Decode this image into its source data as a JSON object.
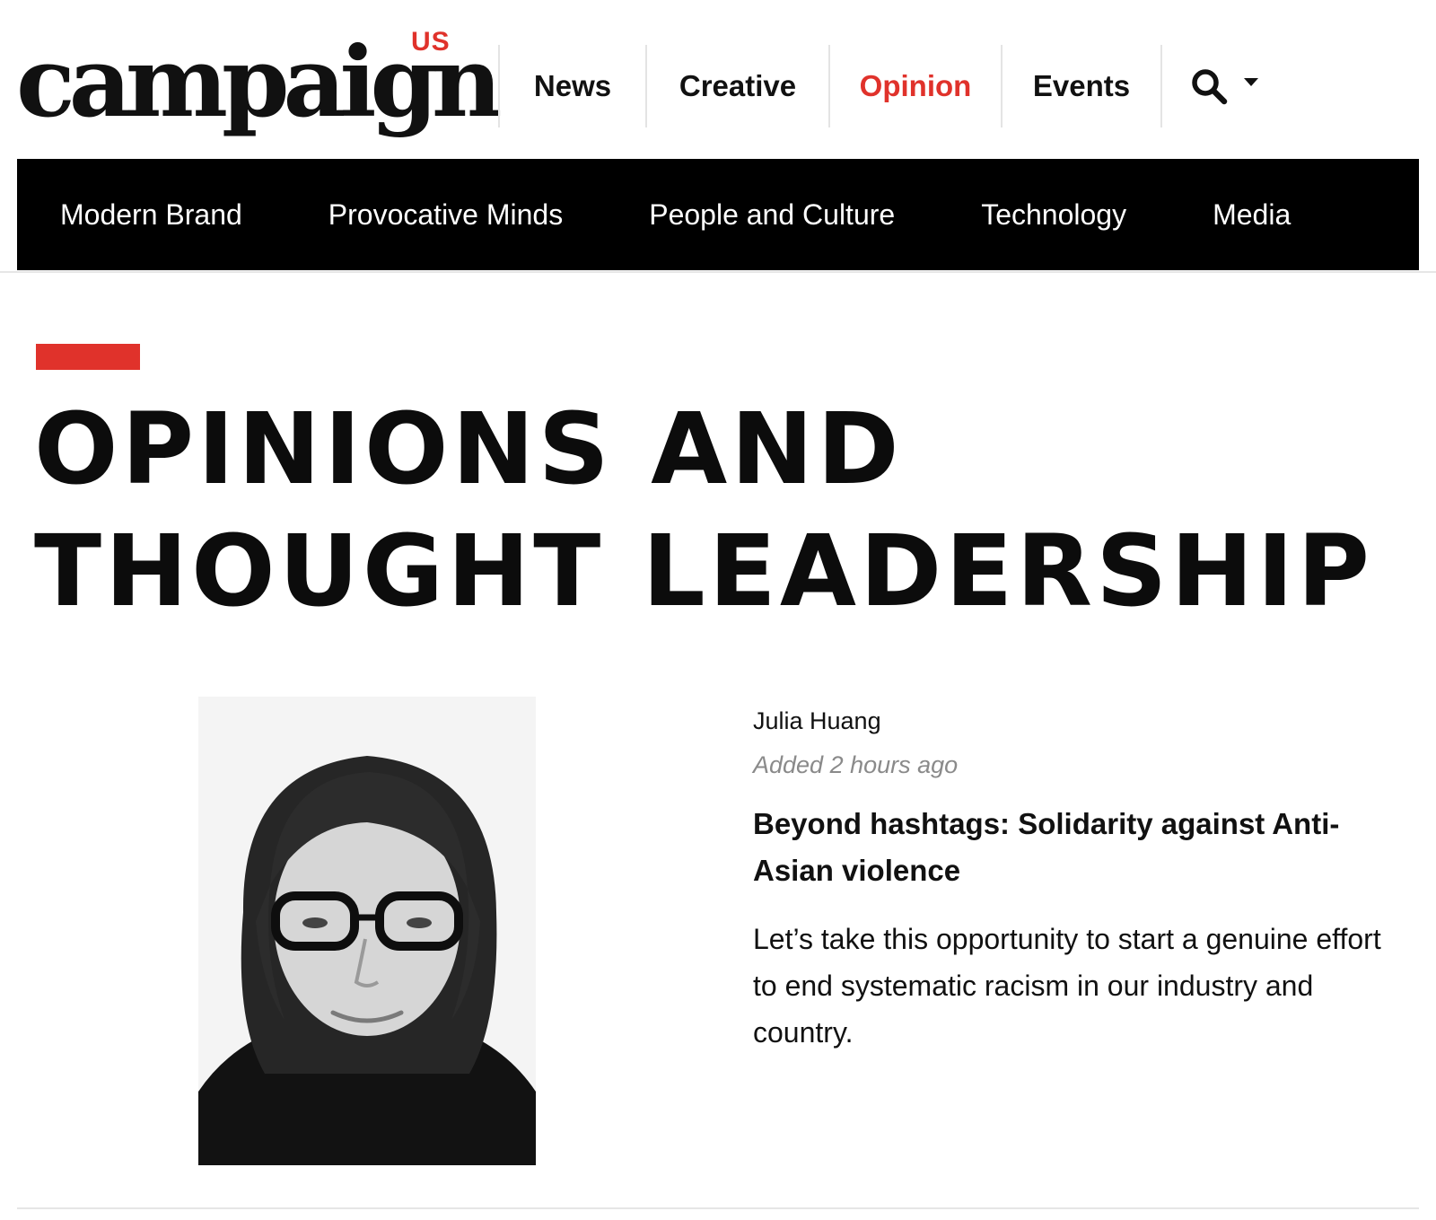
{
  "brand": {
    "logo_text": "campaign",
    "region": "US",
    "accent_color": "#e0322b"
  },
  "topnav": {
    "items": [
      {
        "label": "News"
      },
      {
        "label": "Creative"
      },
      {
        "label": "Opinion",
        "active": true
      },
      {
        "label": "Events"
      }
    ],
    "search_icon": "search-icon",
    "dropdown_icon": "chevron-down-icon"
  },
  "section_nav": {
    "items": [
      {
        "label": "Modern Brand"
      },
      {
        "label": "Provocative Minds"
      },
      {
        "label": "People and Culture"
      },
      {
        "label": "Technology"
      },
      {
        "label": "Media"
      }
    ]
  },
  "page": {
    "title": "OPINIONS AND THOUGHT LEADERSHIP"
  },
  "article": {
    "author": "Julia Huang",
    "timestamp": "Added 2 hours ago",
    "headline": "Beyond hashtags: Solidarity against Anti-Asian violence",
    "summary": "Let’s take this opportunity to start a genuine effort to end systematic racism in our industry and country."
  }
}
